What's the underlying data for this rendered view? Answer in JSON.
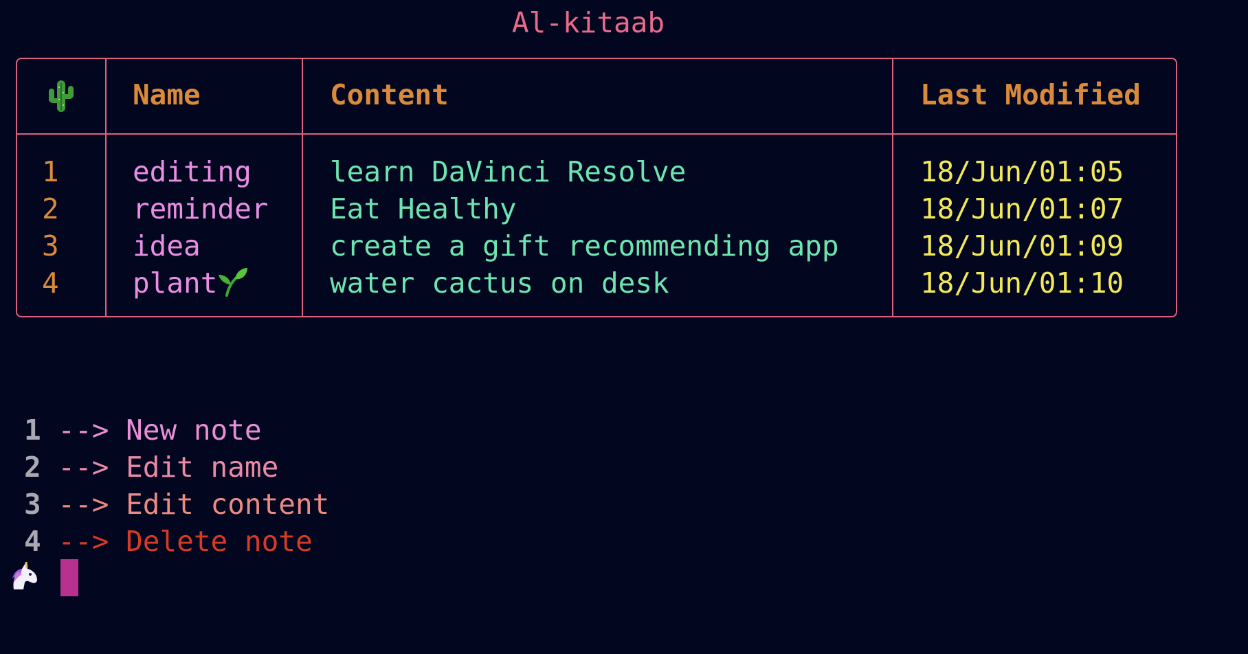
{
  "app": {
    "title": "Al-kitaab"
  },
  "table": {
    "headers": {
      "icon": "cactus-icon",
      "name": "Name",
      "content": "Content",
      "last_modified": "Last Modified"
    },
    "rows": [
      {
        "index": "1",
        "name": "editing",
        "content": "learn DaVinci Resolve",
        "date": "18/Jun/01:05"
      },
      {
        "index": "2",
        "name": "reminder",
        "content": "Eat Healthy",
        "date": "18/Jun/01:07"
      },
      {
        "index": "3",
        "name": "idea",
        "content": "create a gift recommending app",
        "date": "18/Jun/01:09"
      },
      {
        "index": "4",
        "name": "plant",
        "name_icon": "sprout-icon",
        "content": "water cactus on desk",
        "date": "18/Jun/01:10"
      }
    ]
  },
  "menu": {
    "items": [
      {
        "num": "1",
        "arrow": "-->",
        "label": "New note",
        "color": "#e98ed6"
      },
      {
        "num": "2",
        "arrow": "-->",
        "label": "Edit name",
        "color": "#ea8aa6"
      },
      {
        "num": "3",
        "arrow": "-->",
        "label": "Edit content",
        "color": "#ec8a84"
      },
      {
        "num": "4",
        "arrow": "-->",
        "label": "Delete note",
        "color": "#d83a26"
      }
    ]
  },
  "prompt": {
    "icon": "unicorn-icon",
    "cursor_color": "#b9318f"
  },
  "colors": {
    "background": "#02061e",
    "border": "#e0607e",
    "header": "#d98a3a",
    "name": "#e98ee3",
    "content": "#6ee5b0",
    "date": "#f3e957"
  }
}
